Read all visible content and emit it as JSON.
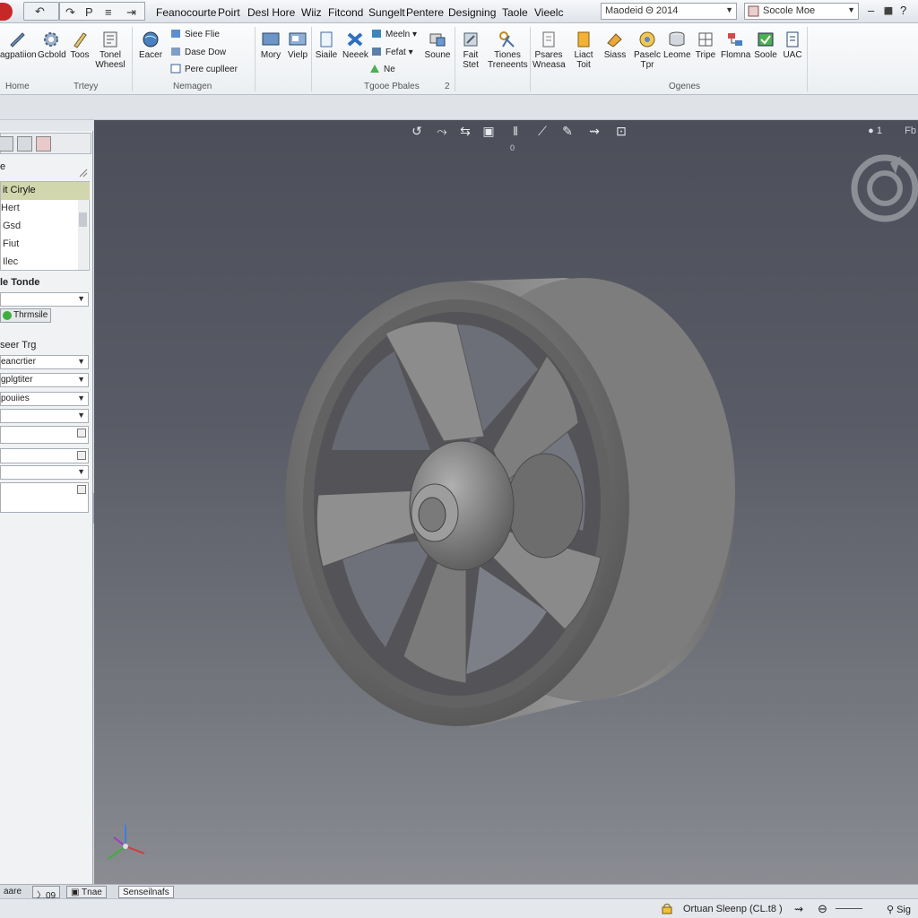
{
  "menu": {
    "items": [
      "Feanocourte",
      "Poirt",
      "Desl Hore",
      "Wiiz",
      "Fitcond",
      "Sungelt",
      "Pentere",
      "Designing",
      "Taole",
      "Vieelc"
    ]
  },
  "quick_access": {
    "undo": "↶",
    "redo": "↷",
    "options": "≡",
    "forward": "⇥"
  },
  "document_field": "Maodeid Θ 2014",
  "search_field": "Socole Moe",
  "window_controls": {
    "minimize": "–",
    "restore": "⬛",
    "help": "?"
  },
  "ribbon": {
    "buttons": [
      {
        "label": "agpatiion",
        "icon": "wrench-icon"
      },
      {
        "label": "Gcbold",
        "icon": "gear-icon"
      },
      {
        "label": "Toos",
        "icon": "pencil-icon"
      },
      {
        "label": "Tonel Wheesl",
        "icon": "wheel-icon"
      },
      {
        "label": "Eacer",
        "icon": "globe-icon"
      },
      {
        "label": "Mory",
        "icon": "monitor-icon"
      },
      {
        "label": "Vielp",
        "icon": "monitor-icon"
      },
      {
        "label": "Siaile",
        "icon": "page-icon"
      },
      {
        "label": "Neeek",
        "icon": "cross-icon"
      },
      {
        "label": "Soune",
        "icon": "stamp-icon"
      },
      {
        "label": "Fait Stet",
        "icon": "tools-icon"
      },
      {
        "label": "Tiones Treneents",
        "icon": "scissors-icon"
      },
      {
        "label": "Psares Wneasa",
        "icon": "document-icon"
      },
      {
        "label": "Liact Toit",
        "icon": "folder-icon"
      },
      {
        "label": "Siass",
        "icon": "tag-icon"
      },
      {
        "label": "Paselc Tpr",
        "icon": "badge-icon"
      },
      {
        "label": "Leome",
        "icon": "cylinder-icon"
      },
      {
        "label": "Tripe",
        "icon": "grid-icon"
      },
      {
        "label": "Flomna",
        "icon": "flow-icon"
      },
      {
        "label": "Soole",
        "icon": "check-icon"
      },
      {
        "label": "UAC",
        "icon": "clipboard-icon"
      }
    ],
    "small_buttons": [
      {
        "label": "Siee Flie"
      },
      {
        "label": "Dase Dow"
      },
      {
        "label": "Pere cuplleer"
      },
      {
        "label": "Meeln"
      },
      {
        "label": "Fefat"
      },
      {
        "label": "Ne"
      }
    ],
    "groups": [
      "Home",
      "Trteyy",
      "Nemagen",
      "Tgooe Pbales",
      "Ogenes"
    ],
    "group_counter": "2"
  },
  "left_panel": {
    "section_title": "e",
    "list_items": [
      "it Ciryle",
      "Hert",
      "Gsd",
      "Fiut",
      "Ilec"
    ],
    "style_label": "le Tonde",
    "thumbnail_button": "Thrmsile",
    "setup_label": "seer Trg",
    "selects": [
      "eancrtier",
      "gplgtiter",
      "pouiies"
    ],
    "fields": [
      "",
      "",
      "",
      "",
      ""
    ]
  },
  "viewport": {
    "counter": "1",
    "extra": "Fb",
    "toolbar_caption": "0"
  },
  "sheet_tabs": [
    "aare",
    "09",
    "Tnae",
    "Senseilnafs"
  ],
  "status": {
    "text": "Ortuan Sleenp (CL.t8 )",
    "zoom": "Sig"
  },
  "colors": {
    "accent_red": "#c62828",
    "selection": "#d2d6ad",
    "viewport_top": "#4c4e59",
    "viewport_bottom": "#8a8c92"
  }
}
